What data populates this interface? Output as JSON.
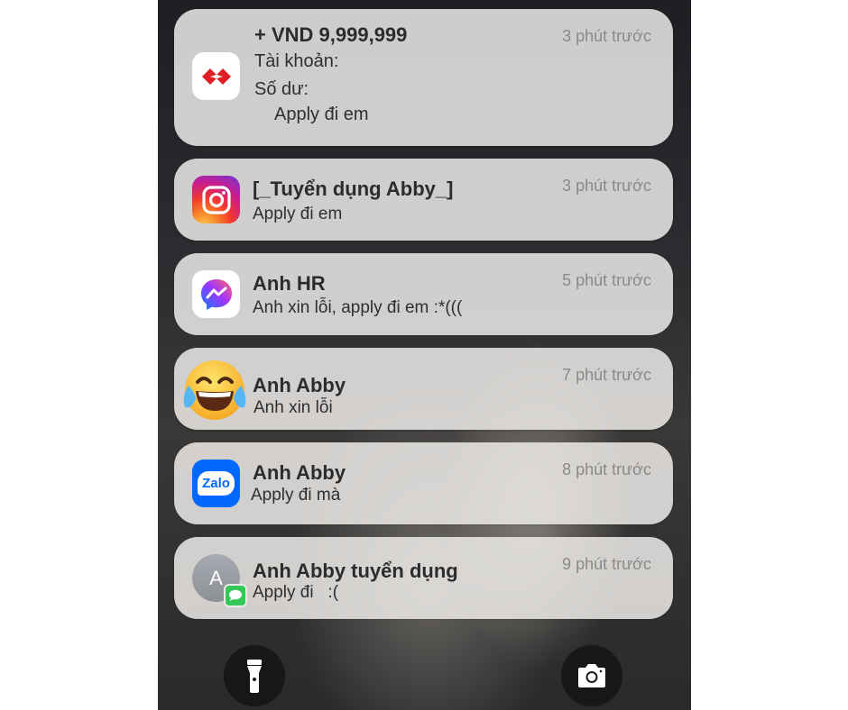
{
  "notifications": [
    {
      "app_icon": "bank-icon",
      "title": "+ VND 9,999,999",
      "lines": [
        "Tài khoản:",
        "Số dư:",
        "Apply đi em"
      ],
      "time": "3 phút trước"
    },
    {
      "app_icon": "instagram-icon",
      "title": "[_Tuyển dụng Abby_]",
      "lines": [
        "Apply đi em"
      ],
      "time": "3 phút trước"
    },
    {
      "app_icon": "messenger-icon",
      "title": "Anh HR",
      "lines": [
        "Anh xin lỗi, apply đi em :*((("
      ],
      "time": "5 phút trước"
    },
    {
      "app_icon": "tears-of-joy-emoji-icon",
      "title": "Anh Abby",
      "lines": [
        "Anh xin lỗi"
      ],
      "time": "7 phút trước"
    },
    {
      "app_icon": "zalo-icon",
      "title": "Anh Abby",
      "lines": [
        "Apply đi mà"
      ],
      "time": "8 phút trước"
    },
    {
      "app_icon": "contact-avatar-icon",
      "avatar_letter": "A",
      "badge_icon": "messages-badge-icon",
      "title": "Anh Abby tuyển dụng",
      "lines": [
        "Apply đi   :("
      ],
      "time": "9 phút trước"
    }
  ],
  "zalo_icon_text": "Zalo",
  "bottom_controls": {
    "left": "flashlight-icon",
    "right": "camera-icon"
  },
  "colors": {
    "card": "#ECEAE8",
    "bank_red": "#E21F26",
    "instagram_gradient": [
      "#FCCB46",
      "#F2392D",
      "#C91D8F",
      "#6A36D6"
    ],
    "messenger_gradient": [
      "#0A7CFF",
      "#A334FA",
      "#FF6968"
    ],
    "zalo_blue": "#0068FF",
    "messages_green": "#34C759"
  }
}
